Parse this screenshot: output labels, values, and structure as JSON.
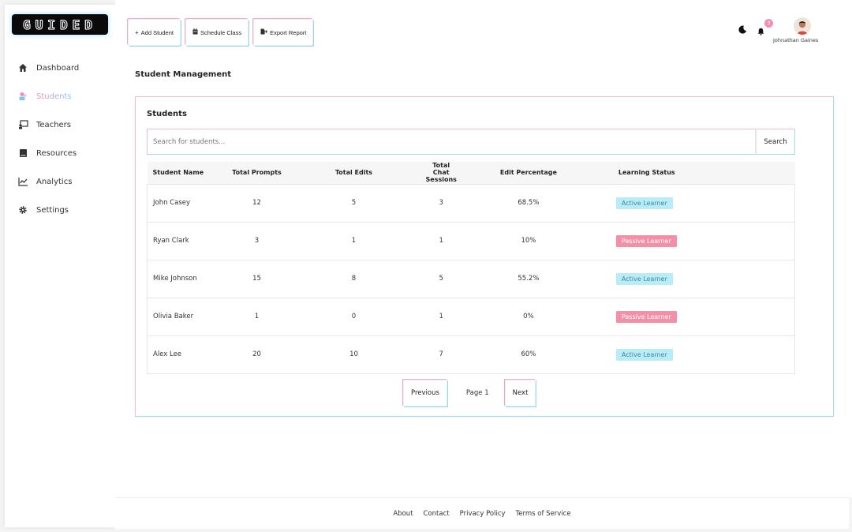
{
  "brand": {
    "logo_text": "GUIDED"
  },
  "sidebar": {
    "items": [
      {
        "label": "Dashboard",
        "icon": "home-icon"
      },
      {
        "label": "Students",
        "icon": "students-icon",
        "active": true
      },
      {
        "label": "Teachers",
        "icon": "teacher-icon"
      },
      {
        "label": "Resources",
        "icon": "book-icon"
      },
      {
        "label": "Analytics",
        "icon": "chart-icon"
      },
      {
        "label": "Settings",
        "icon": "gear-icon"
      }
    ]
  },
  "toolbar": {
    "add_student": "Add Student",
    "schedule_class": "Schedule Class",
    "export_report": "Export Report"
  },
  "header": {
    "notification_count": "3",
    "user_name": "Johnathan Gaines"
  },
  "page": {
    "title": "Student Management"
  },
  "students_card": {
    "title": "Students",
    "search_placeholder": "Search for students...",
    "search_button": "Search",
    "columns": [
      "Student Name",
      "Total Prompts",
      "Total Edits",
      "Total Chat Sessions",
      "Edit Percentage",
      "Learning Status"
    ],
    "rows": [
      {
        "name": "John Casey",
        "prompts": "12",
        "edits": "5",
        "sessions": "3",
        "edit_pct": "68.5%",
        "status": "Active Learner"
      },
      {
        "name": "Ryan Clark",
        "prompts": "3",
        "edits": "1",
        "sessions": "1",
        "edit_pct": "10%",
        "status": "Passive Learner"
      },
      {
        "name": "Mike Johnson",
        "prompts": "15",
        "edits": "8",
        "sessions": "5",
        "edit_pct": "55.2%",
        "status": "Active Learner"
      },
      {
        "name": "Olivia Baker",
        "prompts": "1",
        "edits": "0",
        "sessions": "1",
        "edit_pct": "0%",
        "status": "Passive Learner"
      },
      {
        "name": "Alex Lee",
        "prompts": "20",
        "edits": "10",
        "sessions": "7",
        "edit_pct": "60%",
        "status": "Active Learner"
      }
    ],
    "pagination": {
      "previous": "Previous",
      "page_label": "Page 1",
      "next": "Next"
    }
  },
  "footer": {
    "links": [
      "About",
      "Contact",
      "Privacy Policy",
      "Terms of Service"
    ]
  },
  "colors": {
    "active_pill_bg": "#b9ecf7",
    "passive_pill_bg": "#f48fa8",
    "accent_pink": "#f2a7cd",
    "accent_cyan": "#8fd9f4"
  }
}
